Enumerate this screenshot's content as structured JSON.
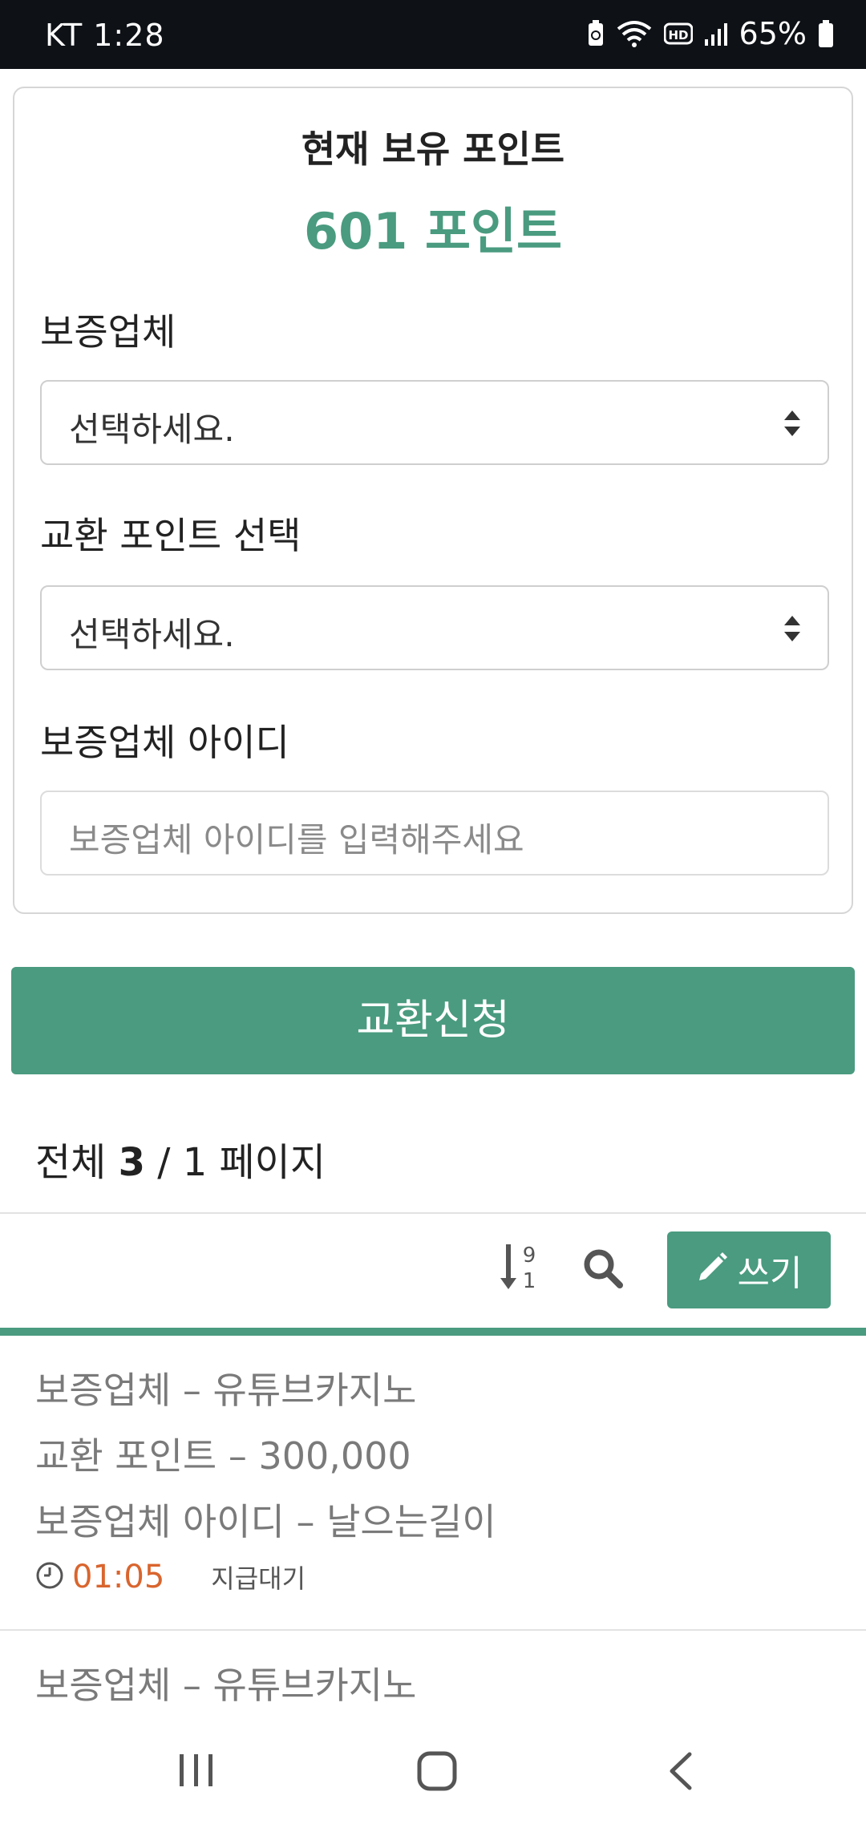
{
  "status_bar": {
    "carrier_time": "KT 1:28",
    "battery": "65%",
    "icons": [
      "battery-saver-icon",
      "wifi-icon",
      "hd-icon",
      "signal-icon",
      "battery-icon"
    ]
  },
  "points_card": {
    "title": "현재 보유 포인트",
    "points": "601 포인트"
  },
  "form": {
    "company_label": "보증업체",
    "company_select_value": "선택하세요.",
    "exchange_label": "교환 포인트 선택",
    "exchange_select_value": "선택하세요.",
    "company_id_label": "보증업체 아이디",
    "company_id_placeholder": "보증업체 아이디를 입력해주세요"
  },
  "submit_label": "교환신청",
  "page_info": {
    "total_label": "전체",
    "total_count": "3",
    "separator": "/",
    "pages": "1 페이지"
  },
  "toolbar": {
    "sort_icon": "sort-numeric-desc-icon",
    "search_icon": "search-icon",
    "write_label": "쓰기"
  },
  "list": {
    "items": [
      {
        "company": "보증업체 – 유튜브카지노",
        "points": "교환 포인트 – 300,000",
        "company_id": "보증업체 아이디 – 날으는길이",
        "time": "01:05",
        "status": "지급대기"
      },
      {
        "company": "보증업체 – 유튜브카지노"
      }
    ]
  },
  "colors": {
    "accent": "#4a9b7f",
    "time": "#d9652e",
    "status_bar": "#0e1217"
  }
}
